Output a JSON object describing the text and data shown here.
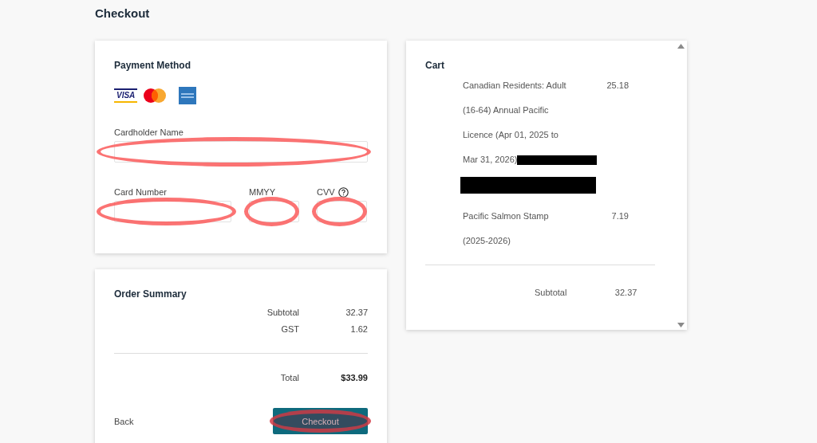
{
  "title": "Checkout",
  "payment": {
    "heading": "Payment Method",
    "card_logos": [
      {
        "kind": "visa",
        "text": "VISA"
      },
      {
        "kind": "mastercard"
      },
      {
        "kind": "amex"
      }
    ],
    "fields": [
      {
        "label": "Cardholder Name",
        "kind": "full",
        "help": false,
        "annotated": true
      },
      {
        "label": "Card Number",
        "kind": "wide",
        "help": false,
        "annotated": true
      },
      {
        "label": "MMYY",
        "kind": "short",
        "help": false,
        "annotated": true
      },
      {
        "label": "CVV",
        "kind": "short",
        "help": true,
        "annotated": true
      }
    ]
  },
  "order_summary": {
    "heading": "Order Summary",
    "rows": [
      {
        "label": "Subtotal",
        "value": "32.37"
      },
      {
        "label": "GST",
        "value": "1.62"
      }
    ],
    "total": {
      "label": "Total",
      "value": "$33.99"
    },
    "back": "Back",
    "checkout": {
      "label": "Checkout",
      "annotated": true
    }
  },
  "cart": {
    "heading": "Cart",
    "items": [
      {
        "lines": [
          "Canadian Residents: Adult",
          "(16-64) Annual Pacific",
          "Licence (Apr 01, 2025 to",
          "Mar 31, 2026)"
        ],
        "price": "25.18",
        "redacted": true
      },
      {
        "lines": [
          "Pacific Salmon Stamp",
          "(2025-2026)"
        ],
        "price": "7.19",
        "redacted": false
      }
    ],
    "subtotal": {
      "label": "Subtotal",
      "value": "32.37"
    }
  }
}
